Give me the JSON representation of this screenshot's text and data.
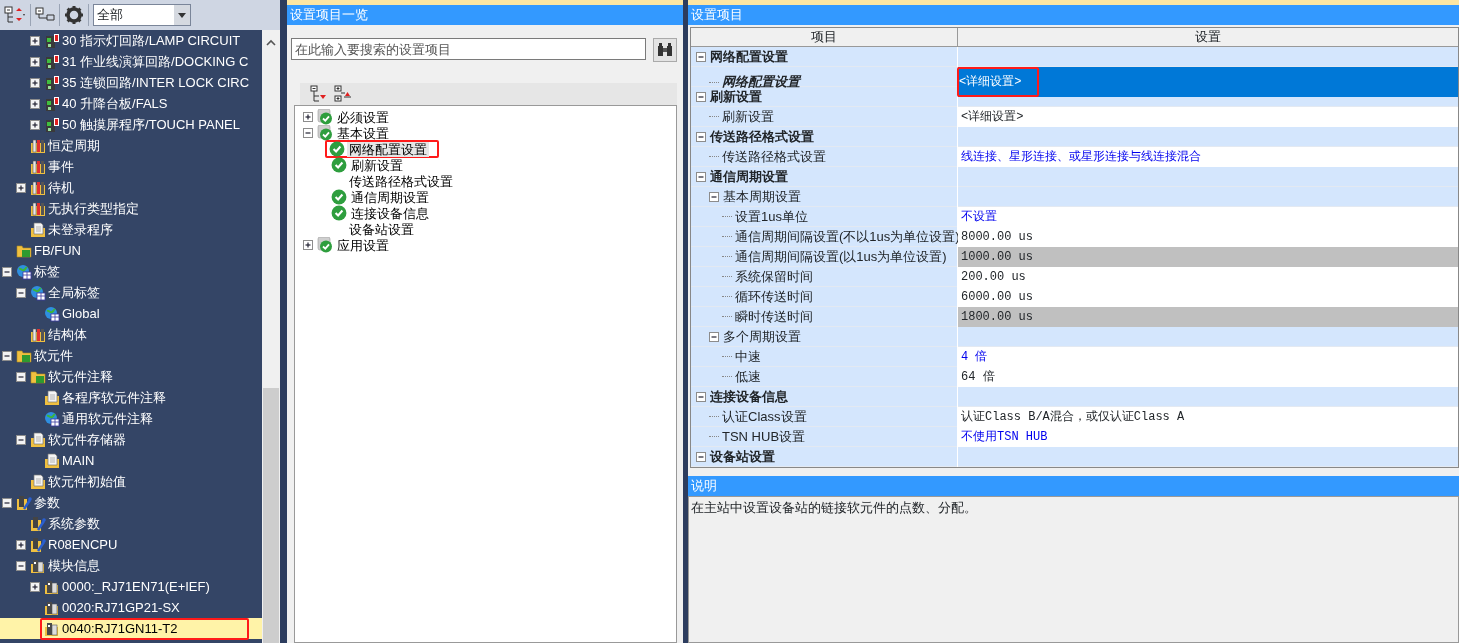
{
  "project_tree": {
    "toolbar": {
      "filter": {
        "value": "全部"
      }
    },
    "items": [
      {
        "children": [
          {
            "children": [
              {
                "label": "30 指示灯回路/LAMP CIRCUIT",
                "kind": "program",
                "expanded": false,
                "selected": false
              },
              {
                "label": "31 作业线演算回路/DOCKING C",
                "kind": "program",
                "expanded": false,
                "selected": false
              },
              {
                "label": "35 连锁回路/INTER LOCK CIRC",
                "kind": "program",
                "expanded": false,
                "selected": false
              },
              {
                "label": "40 升降台板/FALS",
                "kind": "program",
                "expanded": false,
                "selected": false
              },
              {
                "label": "50 触摸屏程序/TOUCH PANEL",
                "kind": "program",
                "expanded": false,
                "selected": false
              }
            ]
          },
          {
            "label": "恒定周期",
            "kind": "binder",
            "selected": false
          },
          {
            "label": "事件",
            "kind": "binder",
            "selected": false
          },
          {
            "label": "待机",
            "kind": "binder",
            "expanded": false,
            "selected": false
          },
          {
            "label": "无执行类型指定",
            "kind": "binder",
            "selected": false
          },
          {
            "label": "未登录程序",
            "kind": "document",
            "selected": false
          }
        ]
      },
      {
        "label": "FB/FUN",
        "kind": "folder",
        "selected": false
      },
      {
        "label": "标签",
        "kind": "globe",
        "expanded": true,
        "selected": false,
        "children": [
          {
            "label": "全局标签",
            "kind": "globe",
            "expanded": true,
            "selected": false,
            "children": [
              {
                "label": "Global",
                "kind": "globe",
                "selected": false
              }
            ]
          },
          {
            "label": "结构体",
            "kind": "binder",
            "selected": false
          }
        ]
      },
      {
        "label": "软元件",
        "kind": "folder",
        "expanded": true,
        "selected": false,
        "children": [
          {
            "label": "软元件注释",
            "kind": "folder",
            "expanded": true,
            "selected": false,
            "children": [
              {
                "label": "各程序软元件注释",
                "kind": "document",
                "selected": false
              },
              {
                "label": "通用软元件注释",
                "kind": "globe",
                "selected": false
              }
            ]
          },
          {
            "label": "软元件存储器",
            "kind": "document",
            "expanded": true,
            "selected": false,
            "children": [
              {
                "label": "MAIN",
                "kind": "document",
                "selected": false
              }
            ]
          },
          {
            "label": "软元件初始值",
            "kind": "document",
            "selected": false
          }
        ]
      },
      {
        "label": "参数",
        "kind": "wrench",
        "expanded": true,
        "selected": false,
        "children": [
          {
            "label": "系统参数",
            "kind": "wrench",
            "selected": false
          },
          {
            "label": "R08ENCPU",
            "kind": "wrench",
            "expanded": false,
            "selected": false
          },
          {
            "label": "模块信息",
            "kind": "module",
            "expanded": true,
            "selected": false,
            "children": [
              {
                "label": "0000:_RJ71EN71(E+IEF)",
                "kind": "module",
                "expanded": false,
                "selected": false
              },
              {
                "label": "0020:RJ71GP21-SX",
                "kind": "module",
                "selected": false
              },
              {
                "label": "0040:RJ71GN11-T2",
                "kind": "module",
                "selected": true,
                "annotated": true
              }
            ]
          }
        ]
      }
    ]
  },
  "settings_list": {
    "title": "设置项目一览",
    "search": {
      "placeholder": "在此输入要搜索的设置项目"
    },
    "items": [
      {
        "label": "必须设置",
        "expanded": false,
        "checked": true
      },
      {
        "label": "基本设置",
        "expanded": true,
        "checked": true,
        "children": [
          {
            "label": "网络配置设置",
            "checked": true,
            "selected": true,
            "annotated": true
          },
          {
            "label": "刷新设置",
            "checked": true,
            "selected": false
          },
          {
            "label": "传送路径格式设置",
            "checked": false,
            "selected": false
          },
          {
            "label": "通信周期设置",
            "checked": true,
            "selected": false
          },
          {
            "label": "连接设备信息",
            "checked": true,
            "selected": false
          },
          {
            "label": "设备站设置",
            "checked": false,
            "selected": false
          }
        ]
      },
      {
        "label": "应用设置",
        "expanded": false,
        "checked": true
      }
    ]
  },
  "settings": {
    "title": "设置项目",
    "columns": [
      "项目",
      "设置"
    ],
    "rows": [
      {
        "label": "网络配置设置",
        "kind": "group",
        "expanded": true,
        "children": [
          {
            "label": "网络配置设置",
            "kind": "item",
            "value": "<详细设置>",
            "selected": true,
            "annotated": true
          }
        ]
      },
      {
        "label": "刷新设置",
        "kind": "group",
        "expanded": true,
        "children": [
          {
            "label": "刷新设置",
            "kind": "item",
            "value": "<详细设置>",
            "selected": false,
            "changed": false,
            "disabled": false
          }
        ]
      },
      {
        "label": "传送路径格式设置",
        "kind": "group",
        "expanded": true,
        "children": [
          {
            "label": "传送路径格式设置",
            "kind": "item",
            "value": "线连接、星形连接、或星形连接与线连接混合",
            "selected": false,
            "changed": true,
            "disabled": false
          }
        ]
      },
      {
        "label": "通信周期设置",
        "kind": "group",
        "expanded": true,
        "children": [
          {
            "label": "基本周期设置",
            "kind": "subgroup",
            "expanded": true,
            "children": [
              {
                "label": "设置1us单位",
                "kind": "item",
                "value": "不设置",
                "selected": false,
                "changed": true,
                "disabled": false
              },
              {
                "label": "通信周期间隔设置(不以1us为单位设置)",
                "kind": "item",
                "value": "8000.00 us",
                "selected": false,
                "changed": false,
                "disabled": false
              },
              {
                "label": "通信周期间隔设置(以1us为单位设置)",
                "kind": "item",
                "value": "1000.00 us",
                "selected": false,
                "changed": false,
                "disabled": true
              },
              {
                "label": "系统保留时间",
                "kind": "item",
                "value": "200.00 us",
                "selected": false,
                "changed": false,
                "disabled": false
              },
              {
                "label": "循环传送时间",
                "kind": "item",
                "value": "6000.00 us",
                "selected": false,
                "changed": false,
                "disabled": false
              },
              {
                "label": "瞬时传送时间",
                "kind": "item",
                "value": "1800.00 us",
                "selected": false,
                "changed": false,
                "disabled": true
              }
            ]
          },
          {
            "label": "多个周期设置",
            "kind": "subgroup",
            "expanded": true,
            "children": [
              {
                "label": "中速",
                "kind": "item",
                "value": "4 倍",
                "selected": false,
                "changed": true,
                "disabled": false
              },
              {
                "label": "低速",
                "kind": "item",
                "value": "64 倍",
                "selected": false,
                "changed": false,
                "disabled": false
              }
            ]
          }
        ]
      },
      {
        "label": "连接设备信息",
        "kind": "group",
        "expanded": true,
        "children": [
          {
            "label": "认证Class设置",
            "kind": "item",
            "value": "认证Class B/A混合，或仅认证Class A",
            "selected": false,
            "changed": false,
            "disabled": false
          },
          {
            "label": "TSN HUB设置",
            "kind": "item",
            "value": "不使用TSN HUB",
            "selected": false,
            "changed": true,
            "disabled": false
          }
        ]
      },
      {
        "label": "设备站设置",
        "kind": "group",
        "expanded": true
      }
    ]
  },
  "description": {
    "title": "说明",
    "text": "在主站中设置设备站的链接软元件的点数、分配。"
  }
}
